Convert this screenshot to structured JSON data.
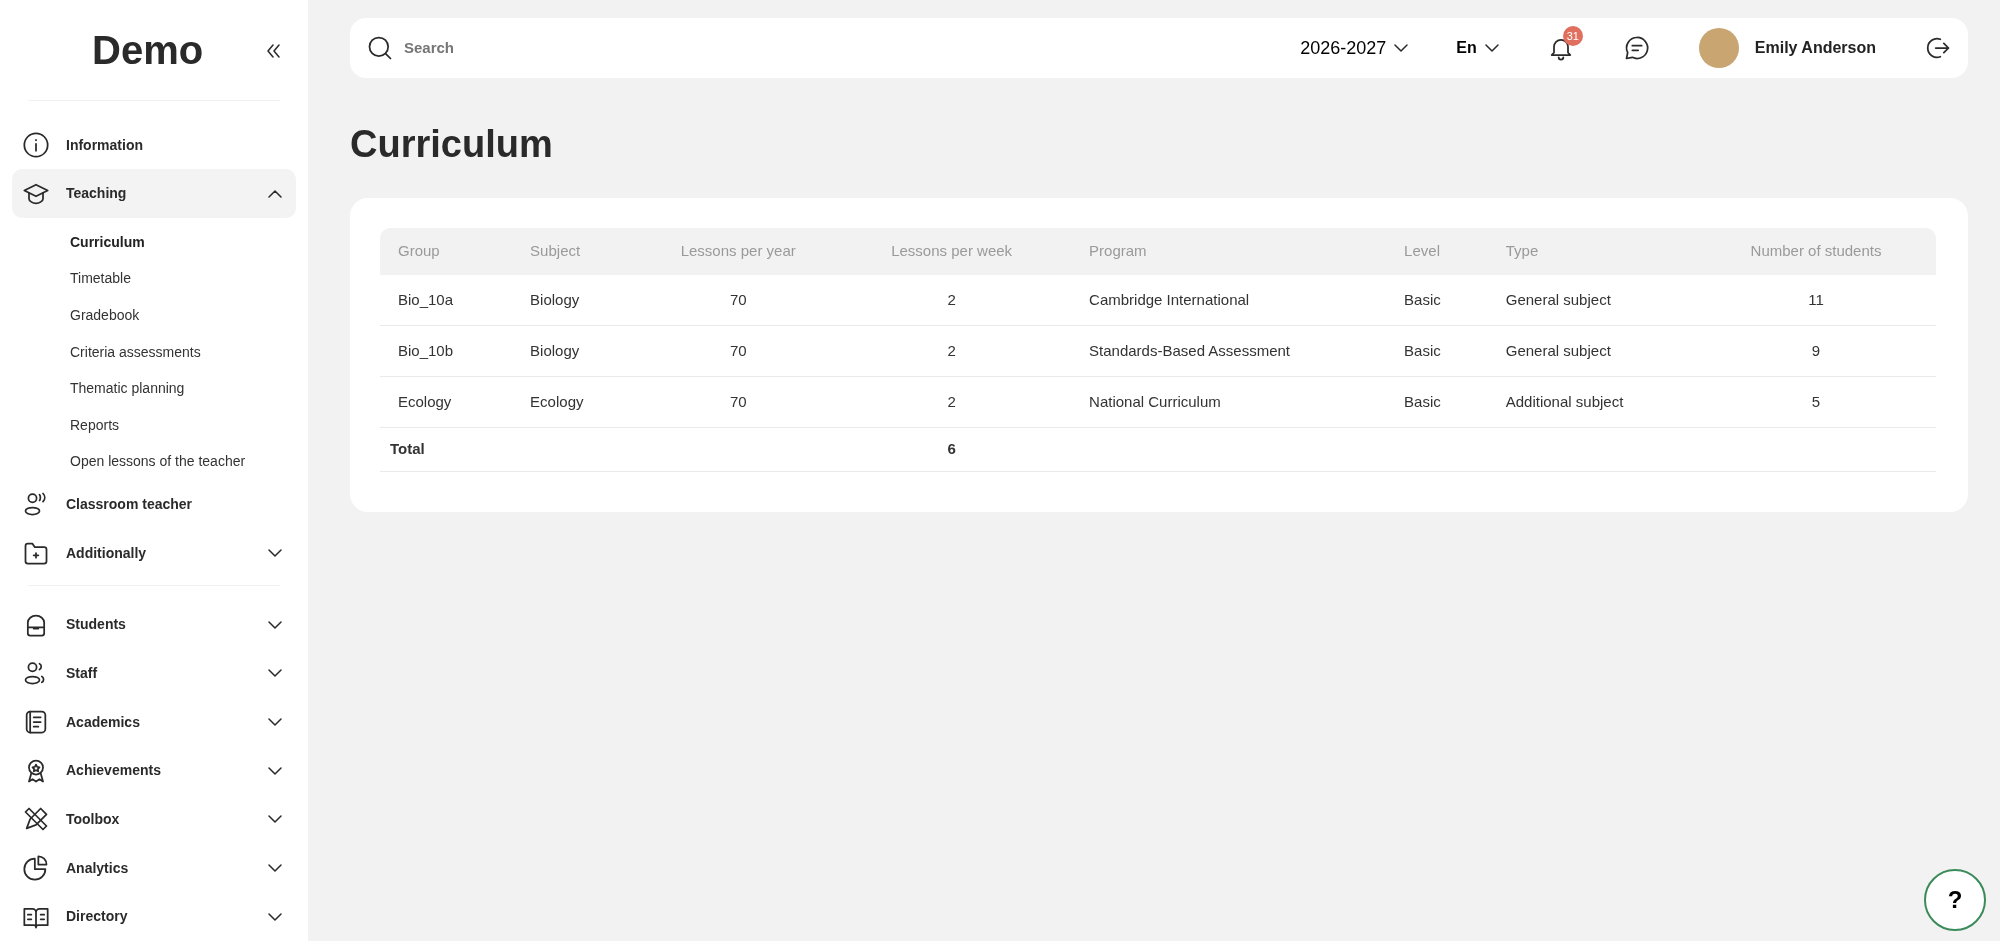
{
  "sidebar": {
    "logo": "Demo",
    "groups": [
      [
        {
          "label": "Information",
          "kind": "link",
          "selected": false
        },
        {
          "label": "Teaching",
          "kind": "group",
          "selected": true,
          "expanded": true,
          "children": [
            {
              "label": "Curriculum",
              "selected": true
            },
            {
              "label": "Timetable",
              "selected": false
            },
            {
              "label": "Gradebook",
              "selected": false
            },
            {
              "label": "Criteria assessments",
              "selected": false
            },
            {
              "label": "Thematic planning",
              "selected": false
            },
            {
              "label": "Reports",
              "selected": false
            },
            {
              "label": "Open lessons of the teacher",
              "selected": false
            }
          ]
        },
        {
          "label": "Classroom teacher",
          "kind": "link",
          "selected": false
        },
        {
          "label": "Additionally",
          "kind": "group",
          "selected": false,
          "expanded": false
        }
      ],
      [
        {
          "label": "Students",
          "kind": "group",
          "selected": false,
          "expanded": false
        },
        {
          "label": "Staff",
          "kind": "group",
          "selected": false,
          "expanded": false
        },
        {
          "label": "Academics",
          "kind": "group",
          "selected": false,
          "expanded": false
        },
        {
          "label": "Achievements",
          "kind": "group",
          "selected": false,
          "expanded": false
        },
        {
          "label": "Toolbox",
          "kind": "group",
          "selected": false,
          "expanded": false
        },
        {
          "label": "Analytics",
          "kind": "group",
          "selected": false,
          "expanded": false
        },
        {
          "label": "Directory",
          "kind": "group",
          "selected": false,
          "expanded": false
        }
      ]
    ]
  },
  "topbar": {
    "search": {
      "placeholder": "Search"
    },
    "year": "2026-2027",
    "language": "En",
    "notifications": "31",
    "user": "Emily Anderson"
  },
  "page_title": "Curriculum",
  "table": {
    "columns": [
      "Group",
      "Subject",
      "Lessons per year",
      "Lessons per week",
      "Program",
      "Level",
      "Type",
      "Number of students"
    ],
    "rows": [
      [
        "Bio_10a",
        "Biology",
        "70",
        "2",
        "Cambridge International",
        "Basic",
        "General subject",
        "11"
      ],
      [
        "Bio_10b",
        "Biology",
        "70",
        "2",
        "Standards-Based Assessment",
        "Basic",
        "General subject",
        "9"
      ],
      [
        "Ecology",
        "Ecology",
        "70",
        "2",
        "National Curriculum",
        "Basic",
        "Additional subject",
        "5"
      ]
    ],
    "total": {
      "label": "Total",
      "lessons_per_week": "6"
    }
  },
  "help_button": "?"
}
